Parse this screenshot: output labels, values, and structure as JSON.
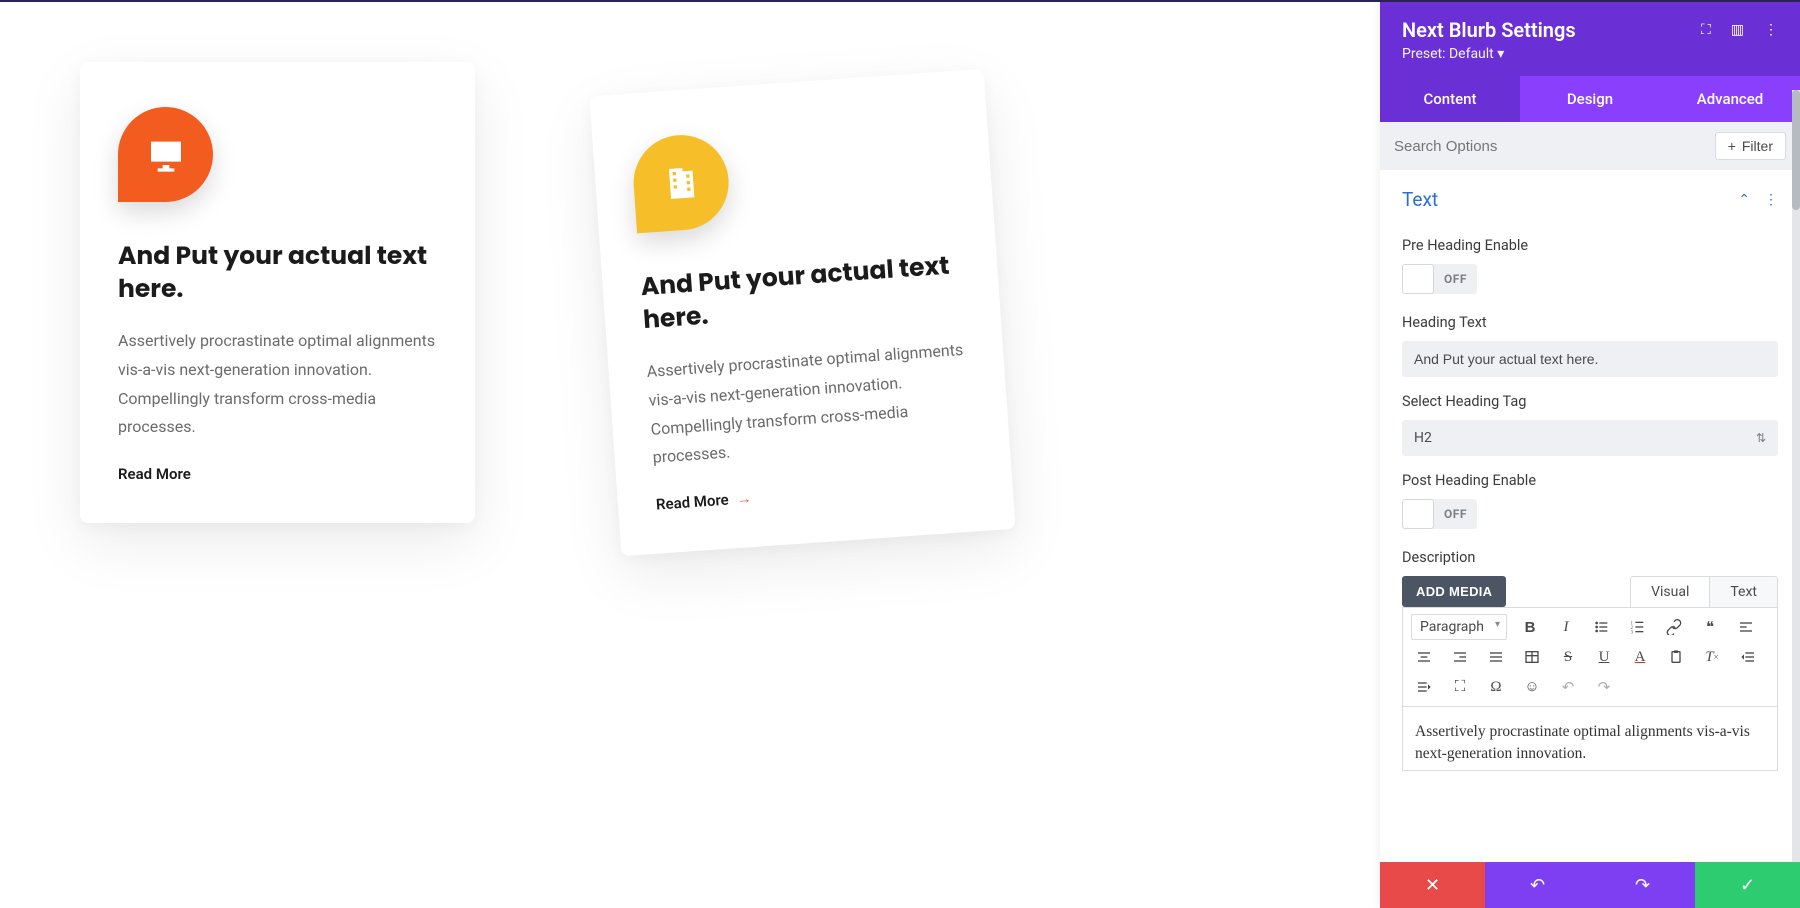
{
  "cards": [
    {
      "heading": "And Put your actual text here.",
      "body": "Assertively procrastinate optimal alignments vis-a-vis next-generation innovation. Compellingly transform cross-media processes.",
      "readmore": "Read More",
      "icon": "monitor-icon",
      "iconColor": "orange"
    },
    {
      "heading": "And Put your actual text here.",
      "body": "Assertively procrastinate optimal alignments vis-a-vis next-generation innovation. Compellingly transform cross-media processes.",
      "readmore": "Read More",
      "icon": "building-icon",
      "iconColor": "yellow"
    }
  ],
  "panel": {
    "title": "Next Blurb Settings",
    "preset": "Preset: Default ▾",
    "tabs": {
      "content": "Content",
      "design": "Design",
      "advanced": "Advanced"
    },
    "searchPlaceholder": "Search Options",
    "filterLabel": "Filter",
    "sections": {
      "text": {
        "title": "Text",
        "preHeadingLabel": "Pre Heading Enable",
        "preHeadingState": "OFF",
        "headingTextLabel": "Heading Text",
        "headingTextValue": "And Put your actual text here.",
        "selectTagLabel": "Select Heading Tag",
        "selectTagValue": "H2",
        "postHeadingLabel": "Post Heading Enable",
        "postHeadingState": "OFF",
        "descriptionLabel": "Description",
        "addMediaLabel": "ADD MEDIA",
        "editorTabs": {
          "visual": "Visual",
          "text": "Text"
        },
        "paragraphSel": "Paragraph",
        "editorContent": "Assertively procrastinate optimal alignments vis-a-vis next-generation innovation."
      }
    }
  }
}
